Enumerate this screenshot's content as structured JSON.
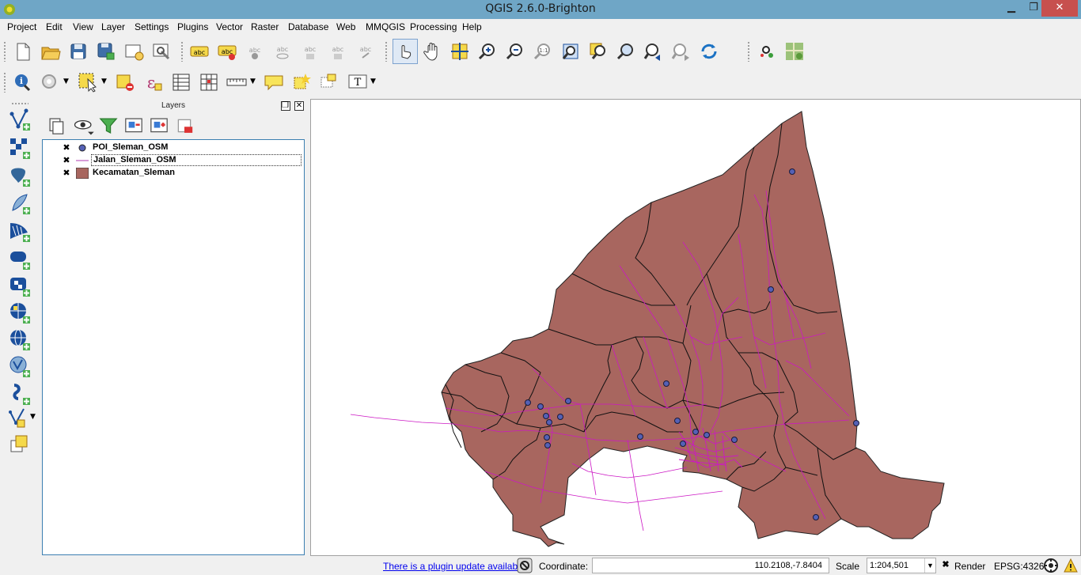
{
  "window": {
    "title": "QGIS 2.6.0-Brighton",
    "minimize": "▁",
    "maximize": "❐",
    "close": "✕"
  },
  "menu": [
    "Project",
    "Edit",
    "View",
    "Layer",
    "Settings",
    "Plugins",
    "Vector",
    "Raster",
    "Database",
    "Web",
    "MMQGIS",
    "Processing",
    "Help"
  ],
  "toolbar_top": {
    "icons": [
      "new-project-icon",
      "open-project-icon",
      "save-project-icon",
      "save-as-icon",
      "new-print-composer-icon",
      "composer-manager-icon",
      "layer-labeling-icon",
      "pin-labels-icon",
      "show-labels-icon",
      "move-label-icon",
      "rotate-label-icon",
      "change-label-icon",
      "label-tool-icon",
      "touch-zoom-icon",
      "pan-icon",
      "pan-to-selection-icon",
      "zoom-in-icon",
      "zoom-out-icon",
      "zoom-native-icon",
      "zoom-full-icon",
      "zoom-to-selection-icon",
      "zoom-to-layer-icon",
      "zoom-last-icon",
      "zoom-next-icon",
      "refresh-icon",
      "georeferencer-icon",
      "openlayers-icon"
    ]
  },
  "toolbar_second": {
    "icons": [
      "identify-icon",
      "run-feature-action-icon",
      "select-features-icon",
      "deselect-icon",
      "select-by-expression-icon",
      "attribute-table-icon",
      "field-calculator-icon",
      "measure-line-icon",
      "map-tips-icon",
      "new-bookmark-icon",
      "show-bookmarks-icon",
      "text-annotation-icon"
    ]
  },
  "left_toolbar": {
    "icons": [
      "add-vector-layer-icon",
      "add-raster-layer-icon",
      "add-postgis-layer-icon",
      "add-spatialite-layer-icon",
      "add-mssql-layer-icon",
      "add-oracle-layer-icon",
      "add-sqlanywhere-layer-icon",
      "add-wms-layer-icon",
      "add-wcs-layer-icon",
      "add-wfs-layer-icon",
      "add-delimited-text-icon",
      "new-shapefile-icon",
      "add-virtual-layer-icon"
    ]
  },
  "layers_panel": {
    "title": "Layers",
    "float_btn": "❐",
    "close_btn": "✕",
    "layers": [
      {
        "name": "POI_Sleman_OSM",
        "checked": "✖",
        "symbol": "point",
        "color": "#5561b5"
      },
      {
        "name": "Jalan_Sleman_OSM",
        "checked": "✖",
        "symbol": "line",
        "color": "#b03ab1"
      },
      {
        "name": "Kecamatan_Sleman",
        "checked": "✖",
        "symbol": "polygon",
        "color": "#a8665f"
      }
    ]
  },
  "map": {
    "polygon_fill": "#a8665f",
    "road_color": "#cc18c4",
    "poi_color": "#5561b5"
  },
  "statusbar": {
    "plugin_update": "There is a plugin update available",
    "coordinate_label": "Coordinate:",
    "coordinate_value": "110.2108,-7.8404",
    "scale_label": "Scale",
    "scale_value": "1:204,501",
    "render_label": "Render",
    "render_checked": "✖",
    "crs": "EPSG:4326"
  }
}
